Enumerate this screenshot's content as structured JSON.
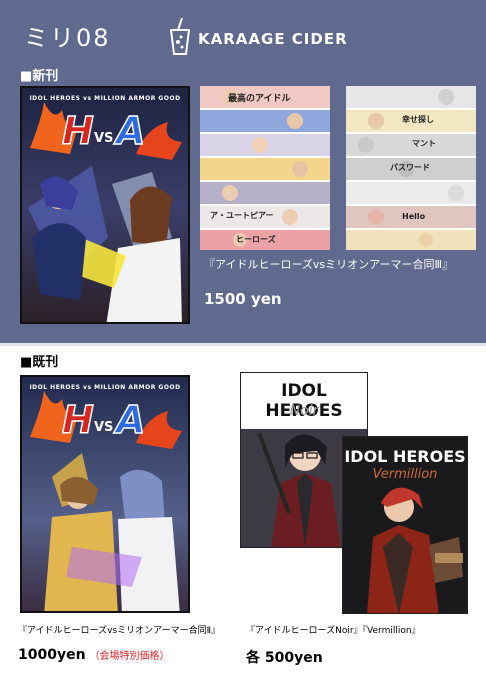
{
  "header": {
    "event_title": "ミリ08",
    "circle_logo": "KARAAGE CIDER",
    "logo_icon": "soda-cup-icon"
  },
  "new_release": {
    "section_label": "■新刊",
    "cover": {
      "series_line": "IDOL HEROES vs MILLION ARMOR GOOD",
      "logo_text": "HvsMA"
    },
    "title": "『アイドルヒーローズvsミリオンアーマー合同Ⅲ』",
    "price": "1500 yen",
    "strip_left": [
      "最高のアイドル",
      "",
      "",
      "",
      "",
      "ア・ユートピアー",
      "ヒーローズ"
    ],
    "strip_right": [
      "",
      "幸せ探し",
      "マント",
      "パスワード",
      "",
      "Hello",
      ""
    ]
  },
  "back_catalog": {
    "section_label": "■既刊",
    "book_1": {
      "series_line": "IDOL HEROES vs MILLION ARMOR GOOD",
      "logo_text": "HvsMA",
      "title": "『アイドルヒーローズvsミリオンアーマー合同Ⅱ』",
      "price": "1000yen",
      "price_note": "（会場特別価格）"
    },
    "book_2": {
      "noir_title": "IDOL HEROES",
      "noir_sub": "Noir",
      "verm_title": "IDOL HEROES",
      "verm_sub": "Vermillion",
      "title": "『アイドルヒーローズNoir』『Vermillion』",
      "price": "各 500yen"
    }
  },
  "colors": {
    "top_panel": "#606a8e",
    "note_red": "#e3222a"
  }
}
